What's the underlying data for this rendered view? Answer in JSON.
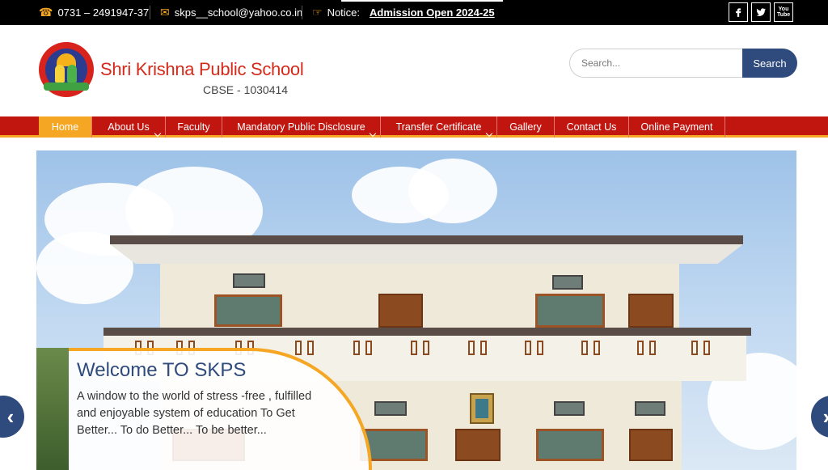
{
  "topbar": {
    "phone": "0731 – 2491947-37",
    "email": "skps__school@yahoo.co.in",
    "notice_label": "Notice:",
    "notice_text": "Admission Open 2024-25",
    "social": [
      "facebook-icon",
      "twitter-icon",
      "youtube-icon"
    ],
    "youtube_text": "You Tube"
  },
  "header": {
    "school_name": "Shri Krishna Public School",
    "cbse": "CBSE - 1030414"
  },
  "search": {
    "placeholder": "Search...",
    "button": "Search"
  },
  "nav": {
    "items": [
      {
        "label": "Home",
        "active": true
      },
      {
        "label": "About Us"
      },
      {
        "label": "Faculty"
      },
      {
        "label": "Mandatory Public Disclosure"
      },
      {
        "label": "Transfer Certificate"
      },
      {
        "label": "Gallery"
      },
      {
        "label": "Contact Us"
      },
      {
        "label": "Online Payment"
      }
    ]
  },
  "slider": {
    "title": "Welcome TO SKPS",
    "text": "A window to the world of stress -free , fulfilled and enjoyable system of education To Get Better... To do Better... To be better...",
    "prev": "‹",
    "next": "›"
  },
  "colors": {
    "nav_red": "#c0160f",
    "accent_orange": "#f5a623",
    "brand_blue": "#2f4a7d"
  }
}
